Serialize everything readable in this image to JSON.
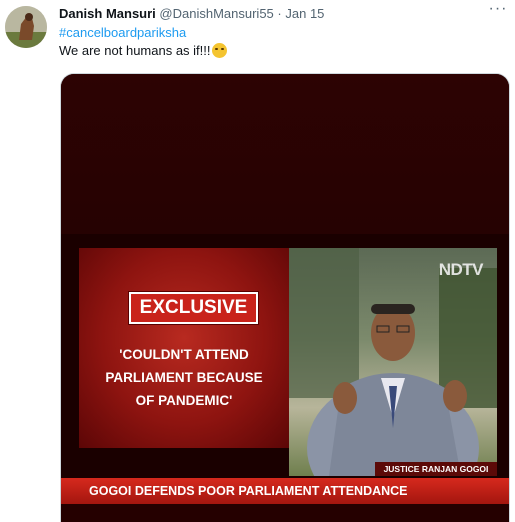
{
  "tweet": {
    "display_name": "Danish Mansuri",
    "handle": "@DanishMansuri55",
    "separator": "·",
    "date": "Jan 15",
    "more_icon": "more-horizontal-icon",
    "hashtag": "#cancelboardpariksha",
    "text": "We are not humans as if!!!",
    "emoji": "face-with-rolling-eyes"
  },
  "media": {
    "exclusive_label": "EXCLUSIVE",
    "quote": "'COULDN'T ATTEND\nPARLIAMENT BECAUSE\nOF PANDEMIC'",
    "channel_logo": "NDTV",
    "name_tag": "JUSTICE RANJAN GOGOI",
    "ticker": "GOGOI DEFENDS POOR PARLIAMENT ATTENDANCE"
  },
  "colors": {
    "link_blue": "#1d9bf0",
    "secondary_text": "#536471",
    "broadcast_red": "#c9231b"
  }
}
